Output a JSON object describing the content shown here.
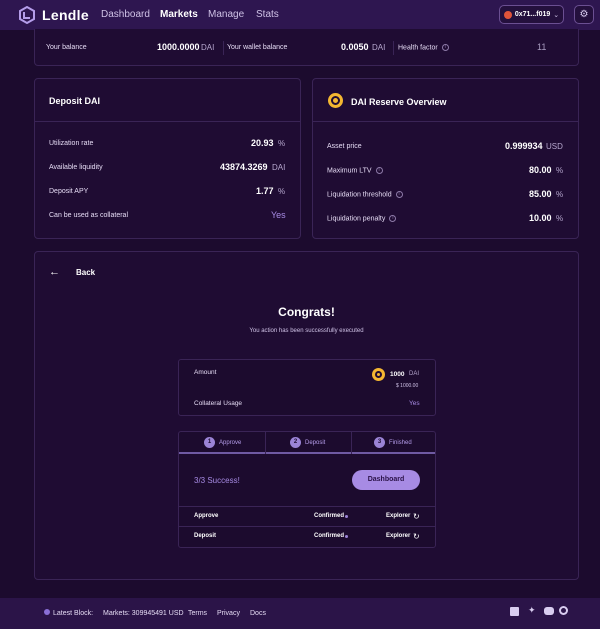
{
  "app": {
    "name": "Lendle"
  },
  "nav": {
    "items": [
      {
        "label": "Dashboard",
        "active": false
      },
      {
        "label": "Markets",
        "active": true
      },
      {
        "label": "Manage",
        "active": false
      },
      {
        "label": "Stats",
        "active": false
      }
    ],
    "wallet": "0x71...f019"
  },
  "balances": {
    "your_balance_label": "Your balance",
    "your_balance_value": "1000.0000",
    "your_balance_unit": "DAI",
    "wallet_balance_label": "Your wallet balance",
    "wallet_balance_value": "0.0050",
    "wallet_balance_unit": "DAI",
    "health_factor_label": "Health factor",
    "health_factor_value": "11"
  },
  "deposit_panel": {
    "title": "Deposit DAI",
    "utilization_label": "Utilization rate",
    "utilization_value": "20.93",
    "utilization_unit": "%",
    "liquidity_label": "Available liquidity",
    "liquidity_value": "43874.3269",
    "liquidity_unit": "DAI",
    "apy_label": "Deposit APY",
    "apy_value": "1.77",
    "apy_unit": "%",
    "collateral_label": "Can be used as collateral",
    "collateral_value": "Yes"
  },
  "reserve_panel": {
    "title": "DAI Reserve Overview",
    "price_label": "Asset price",
    "price_value": "0.999934",
    "price_unit": "USD",
    "ltv_label": "Maximum LTV",
    "ltv_value": "80.00",
    "ltv_unit": "%",
    "threshold_label": "Liquidation threshold",
    "threshold_value": "85.00",
    "threshold_unit": "%",
    "penalty_label": "Liquidation penalty",
    "penalty_value": "10.00",
    "penalty_unit": "%"
  },
  "result": {
    "back_label": "Back",
    "heading": "Congrats!",
    "message": "You action has been successfully executed",
    "amount_label": "Amount",
    "amount_value": "1000",
    "amount_unit": "DAI",
    "amount_usd": "$ 1000.00",
    "collateral_label": "Collateral Usage",
    "collateral_value": "Yes",
    "steps": [
      {
        "num": "1",
        "label": "Approve"
      },
      {
        "num": "2",
        "label": "Deposit"
      },
      {
        "num": "3",
        "label": "Finished"
      }
    ],
    "success_text": "3/3 Success!",
    "dashboard_button": "Dashboard",
    "tx_rows": [
      {
        "label": "Approve",
        "status": "Confirmed",
        "link": "Explorer"
      },
      {
        "label": "Deposit",
        "status": "Confirmed",
        "link": "Explorer"
      }
    ]
  },
  "footer": {
    "latest_block": "Latest Block:",
    "markets": "Markets: 309945491 USD",
    "terms": "Terms",
    "privacy": "Privacy",
    "docs": "Docs"
  },
  "colors": {
    "accent": "#a78be4",
    "background": "#1c0b2e",
    "nav": "#2e1650",
    "success_dot": "#9b84d6"
  }
}
